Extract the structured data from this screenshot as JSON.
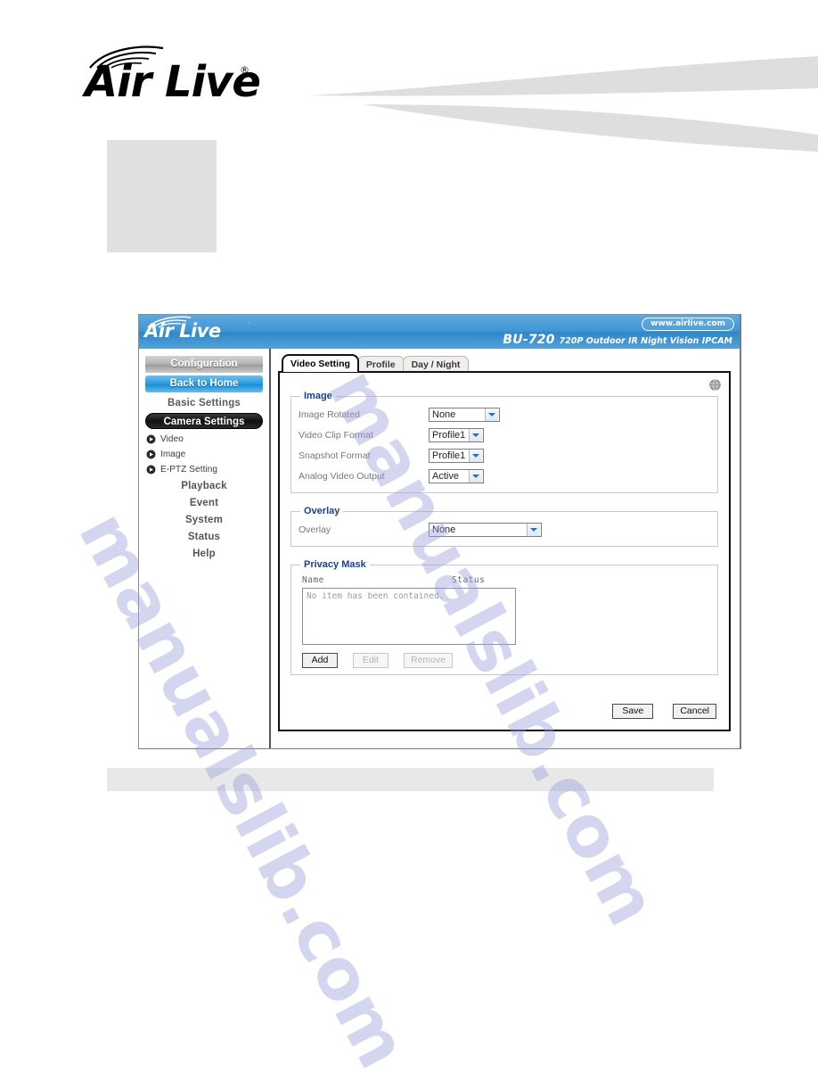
{
  "manual_page": {
    "brand": {
      "wordmark": "Air Live",
      "registered_mark": "®"
    },
    "watermark": "manualslib.com"
  },
  "device_ui": {
    "topbar": {
      "brand_wordmark": "Air Live",
      "registered_mark": "´",
      "url_badge": "www.airlive.com",
      "model_name": "BU-720",
      "model_description": "720P Outdoor IR Night Vision IPCAM"
    },
    "sidebar": {
      "configuration_label": "Configuration",
      "back_to_home_label": "Back to Home",
      "basic_settings_label": "Basic Settings",
      "camera_settings_label": "Camera Settings",
      "sub_items": [
        {
          "label": "Video",
          "icon": "play-bullet-icon"
        },
        {
          "label": "Image",
          "icon": "play-bullet-icon"
        },
        {
          "label": "E-PTZ Setting",
          "icon": "play-bullet-icon"
        }
      ],
      "menu_items": [
        {
          "label": "Playback"
        },
        {
          "label": "Event"
        },
        {
          "label": "System"
        },
        {
          "label": "Status"
        },
        {
          "label": "Help"
        }
      ]
    },
    "tabs": [
      {
        "label": "Video Setting",
        "active": true
      },
      {
        "label": "Profile",
        "active": false
      },
      {
        "label": "Day / Night",
        "active": false
      }
    ],
    "help_icon": "help-globe-icon",
    "image_section": {
      "legend": "Image",
      "fields": [
        {
          "label": "Image Rotated",
          "value": "None"
        },
        {
          "label": "Video Clip Format",
          "value": "Profile1"
        },
        {
          "label": "Snapshot Format",
          "value": "Profile1"
        },
        {
          "label": "Analog Video Output",
          "value": "Active"
        }
      ]
    },
    "overlay_section": {
      "legend": "Overlay",
      "field": {
        "label": "Overlay",
        "value": "None"
      }
    },
    "privacy_mask_section": {
      "legend": "Privacy Mask",
      "columns": {
        "name": "Name",
        "status": "Status"
      },
      "empty_message": "No item has been contained.",
      "buttons": [
        {
          "label": "Add",
          "enabled": true
        },
        {
          "label": "Edit",
          "enabled": false
        },
        {
          "label": "Remove",
          "enabled": false
        }
      ]
    },
    "form_buttons": [
      {
        "label": "Save"
      },
      {
        "label": "Cancel"
      }
    ]
  },
  "colors": {
    "header_blue": "#3f95d4",
    "legend_blue": "#1c3f8f",
    "nav_home_blue": "#2e9fe0",
    "placeholder_gray": "#e0e0e0"
  }
}
